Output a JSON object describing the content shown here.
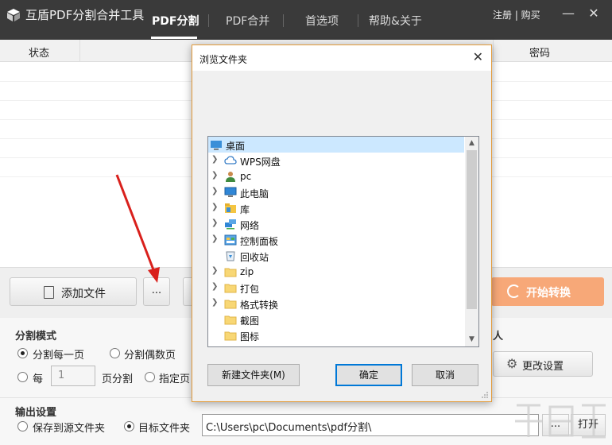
{
  "app": {
    "title": "互盾PDF分割合并工具",
    "tabs": [
      {
        "label": "PDF分割",
        "active": true
      },
      {
        "label": "PDF合并",
        "active": false
      },
      {
        "label": "首选项",
        "active": false
      },
      {
        "label": "帮助&关于",
        "active": false
      }
    ],
    "register_link": "注册 | 购买",
    "minimize_glyph": "—",
    "close_glyph": "✕"
  },
  "table": {
    "col_status": "状态",
    "col_password": "密码"
  },
  "toolbar": {
    "add_file_label": "添加文件",
    "more_label": "...",
    "start_label": "开始转换"
  },
  "split": {
    "section_title": "分割模式",
    "option_each_page": "分割每一页",
    "option_even_pages": "分割偶数页",
    "option_every": "每",
    "every_value": "1",
    "pages_split": "页分割",
    "option_specified": "指定页",
    "side_label": "人",
    "change_settings_label": "更改设置"
  },
  "output": {
    "section_title": "输出设置",
    "option_save_source": "保存到源文件夹",
    "option_target": "目标文件夹",
    "path_value": "C:\\Users\\pc\\Documents\\pdf分割\\",
    "browse_label": "...",
    "open_label": "打开"
  },
  "dialog": {
    "title": "浏览文件夹",
    "close_glyph": "✕",
    "tree_items": [
      {
        "label": "桌面",
        "icon": "desktop-icon",
        "expandable": false,
        "selected": true
      },
      {
        "label": "WPS网盘",
        "icon": "cloud-icon",
        "expandable": true
      },
      {
        "label": "pc",
        "icon": "user-icon",
        "expandable": true
      },
      {
        "label": "此电脑",
        "icon": "computer-icon",
        "expandable": true
      },
      {
        "label": "库",
        "icon": "library-icon",
        "expandable": true
      },
      {
        "label": "网络",
        "icon": "network-icon",
        "expandable": true
      },
      {
        "label": "控制面板",
        "icon": "control-panel-icon",
        "expandable": true
      },
      {
        "label": "回收站",
        "icon": "recycle-bin-icon",
        "expandable": false
      },
      {
        "label": "zip",
        "icon": "folder-icon",
        "expandable": true
      },
      {
        "label": "打包",
        "icon": "folder-icon",
        "expandable": true
      },
      {
        "label": "格式转换",
        "icon": "folder-icon",
        "expandable": true
      },
      {
        "label": "截图",
        "icon": "folder-icon",
        "expandable": false
      },
      {
        "label": "图标",
        "icon": "folder-icon",
        "expandable": false
      }
    ],
    "new_folder_label": "新建文件夹(M)",
    "ok_label": "确定",
    "cancel_label": "取消"
  },
  "colors": {
    "titlebar": "#3a3a3a",
    "start_button": "#f7a878",
    "dialog_border": "#e39b3a",
    "selection": "#cce8ff",
    "annotation_arrow": "#d9201c"
  }
}
